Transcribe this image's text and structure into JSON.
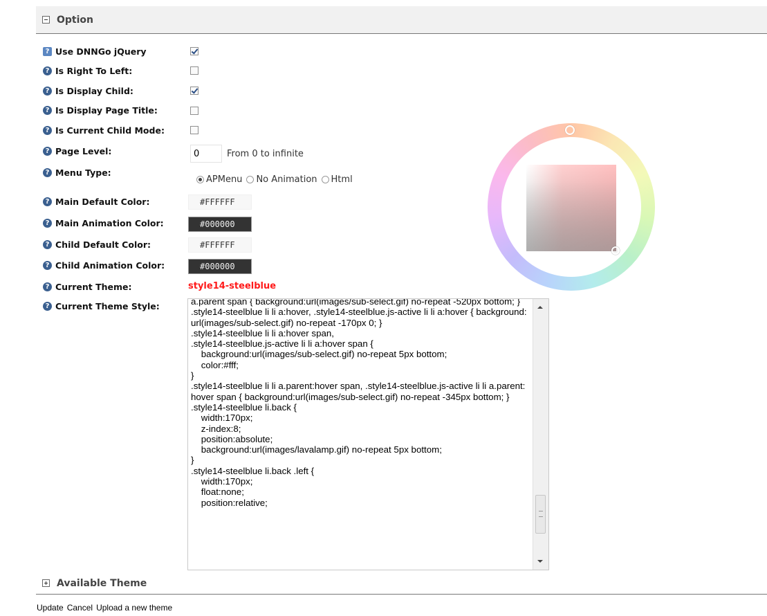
{
  "option_section": {
    "title": "Option",
    "toggle": "collapse"
  },
  "settings": {
    "use_dnngo_jquery": {
      "label": "Use DNNGo jQuery",
      "checked": true
    },
    "is_right_to_left": {
      "label": "Is Right To Left:",
      "checked": false
    },
    "is_display_child": {
      "label": "Is Display Child:",
      "checked": true
    },
    "is_display_page_title": {
      "label": "Is Display Page Title:",
      "checked": false
    },
    "is_current_child_mode": {
      "label": "Is Current Child Mode:",
      "checked": false
    },
    "page_level": {
      "label": "Page Level:",
      "value": "0",
      "hint": "From 0 to infinite"
    },
    "menu_type": {
      "label": "Menu Type:",
      "options": [
        "APMenu",
        "No Animation",
        "Html"
      ],
      "selected": "APMenu"
    },
    "main_default_color": {
      "label": "Main Default Color:",
      "value": "#FFFFFF"
    },
    "main_animation_color": {
      "label": "Main Animation Color:",
      "value": "#000000"
    },
    "child_default_color": {
      "label": "Child Default Color:",
      "value": "#FFFFFF"
    },
    "child_animation_color": {
      "label": "Child Animation Color:",
      "value": "#000000"
    },
    "current_theme": {
      "label": "Current Theme:",
      "value": "style14-steelblue"
    },
    "current_theme_style": {
      "label": "Current Theme Style:",
      "code": "a.parent span { background:url(images/sub-select.gif) no-repeat -520px bottom; }\n.style14-steelblue li li a:hover, .style14-steelblue.js-active li li a:hover { background:url(images/sub-select.gif) no-repeat -170px 0; }\n.style14-steelblue li li a:hover span,\n.style14-steelblue.js-active li li a:hover span {\n    background:url(images/sub-select.gif) no-repeat 5px bottom;\n    color:#fff;\n}\n.style14-steelblue li li a.parent:hover span, .style14-steelblue.js-active li li a.parent:hover span { background:url(images/sub-select.gif) no-repeat -345px bottom; }\n.style14-steelblue li.back {\n    width:170px;\n    z-index:8;\n    position:absolute;\n    background:url(images/lavalamp.gif) no-repeat 5px bottom;\n}\n.style14-steelblue li.back .left {\n    width:170px;\n    float:none;\n    position:relative;"
    }
  },
  "colors": {
    "theme_name": "#ff1a1a",
    "help_icon": "#3a5f8f",
    "swatch_dark": "#333333",
    "swatch_light": "#f7f7f7"
  },
  "available_section": {
    "title": "Available Theme",
    "toggle": "expand"
  },
  "footer": {
    "update": "Update",
    "cancel": "Cancel",
    "upload": "Upload a new theme"
  }
}
